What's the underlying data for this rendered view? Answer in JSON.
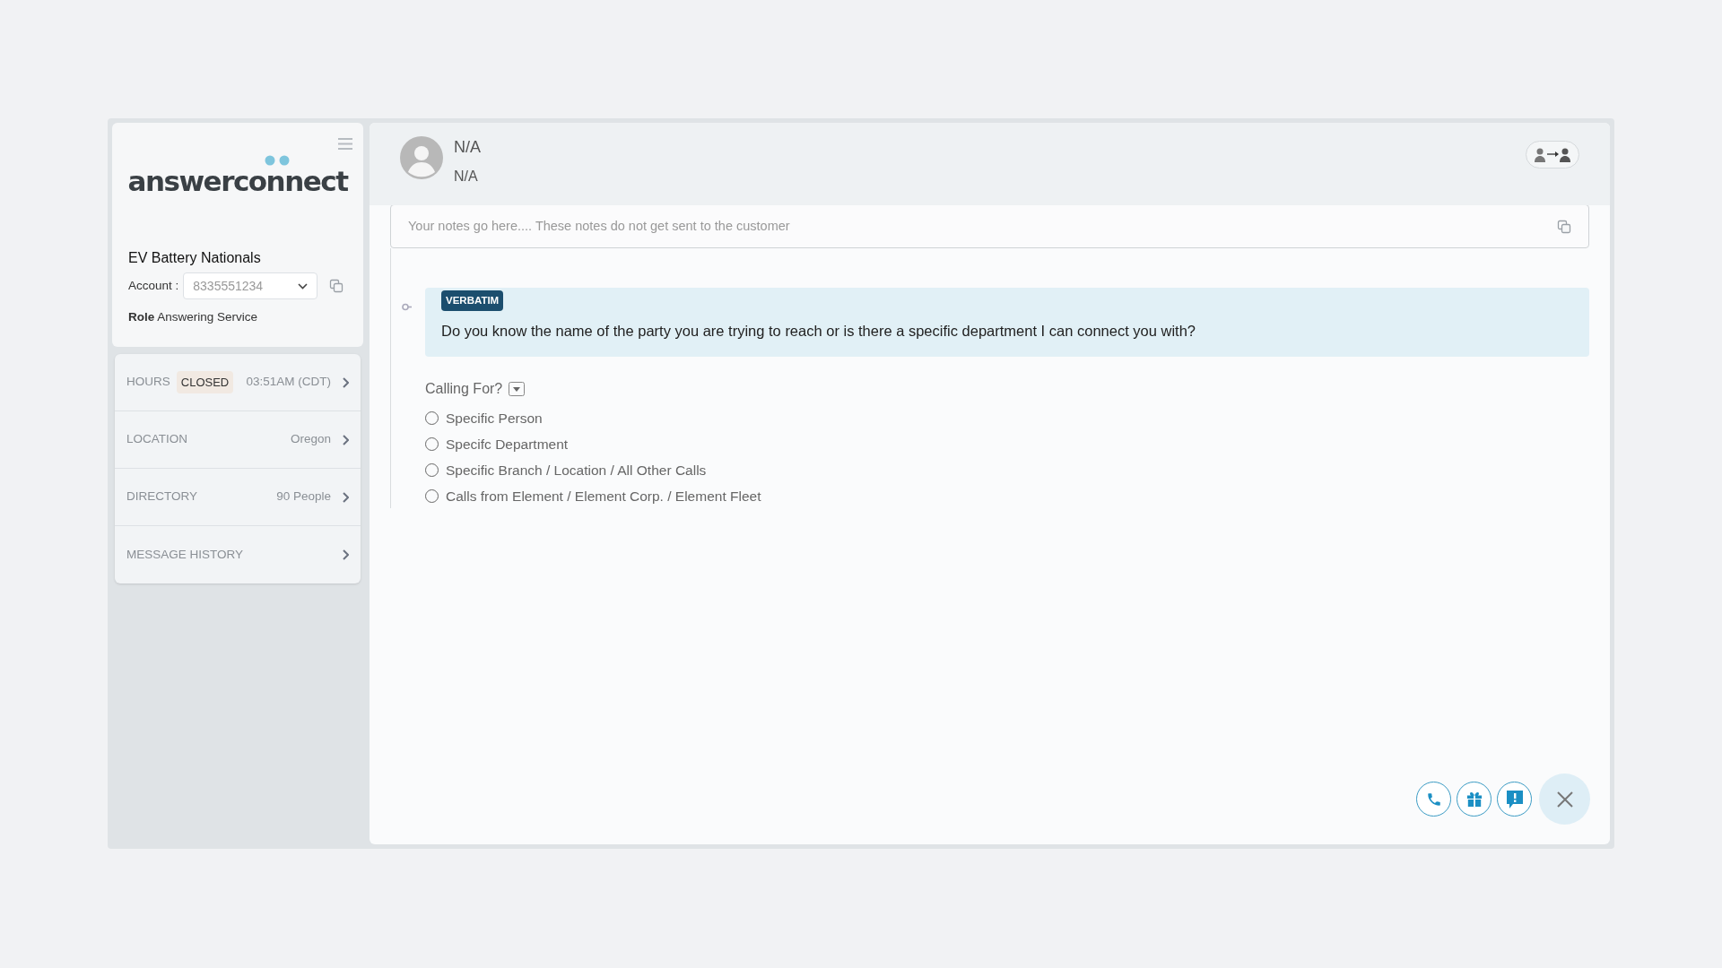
{
  "sidebar": {
    "logo": "answerconnect",
    "company": "EV Battery Nationals",
    "account_label": "Account :",
    "account_value": "8335551234",
    "role_label": "Role",
    "role_value": "Answering Service",
    "rows": [
      {
        "label": "HOURS",
        "badge": "CLOSED",
        "value": "03:51AM (CDT)"
      },
      {
        "label": "LOCATION",
        "value": "Oregon"
      },
      {
        "label": "DIRECTORY",
        "value": "90 People"
      },
      {
        "label": "MESSAGE HISTORY"
      }
    ]
  },
  "caller": {
    "name": "N/A",
    "number": "N/A"
  },
  "notes": {
    "placeholder": "Your notes go here.... These notes do not get sent to the customer"
  },
  "script": {
    "tag": "VERBATIM",
    "text": "Do you know the name of the party you are trying to reach or is there a specific department I can connect you with?"
  },
  "question": {
    "label": "Calling For?",
    "options": [
      {
        "label": "Specific Person",
        "selected": false
      },
      {
        "label": "Specifc Department",
        "selected": false
      },
      {
        "label": "Specific Branch / Location / All Other Calls",
        "selected": false
      },
      {
        "label": "Calls from Element / Element Corp. / Element Fleet",
        "selected": false
      }
    ]
  }
}
